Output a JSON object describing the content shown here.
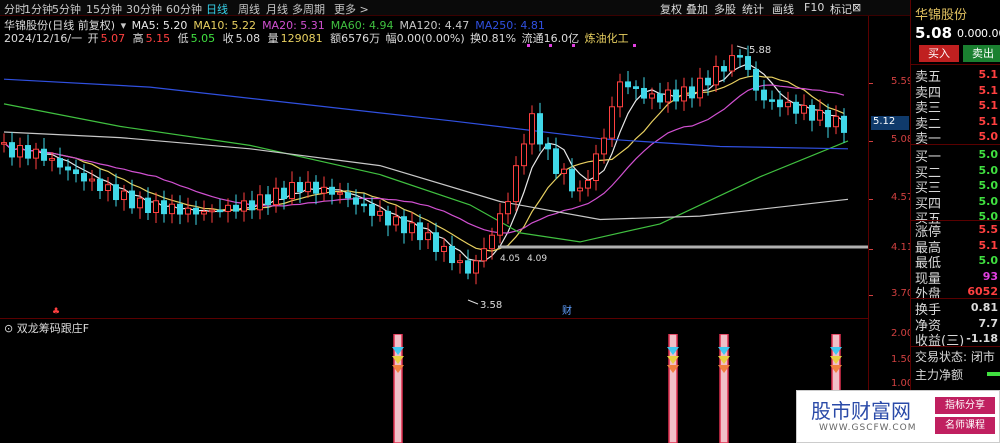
{
  "toolbar": {
    "timeframes": [
      "分时",
      "1分钟",
      "5分钟",
      "15分钟",
      "30分钟",
      "60分钟",
      "日线",
      "周线",
      "月线",
      "多周期",
      "更多 >"
    ],
    "active": "日线",
    "tools": [
      "复权",
      "叠加",
      "多股",
      "统计",
      "画线",
      "F10",
      "标记"
    ]
  },
  "stock": {
    "title": "华锦股份(日线 前复权)",
    "ma": [
      {
        "label": "MA5: 5.20",
        "color": "#e8e8e8"
      },
      {
        "label": "MA10: 5.22",
        "color": "#e8d060"
      },
      {
        "label": "MA20: 5.31",
        "color": "#d050d0"
      },
      {
        "label": "MA60: 4.94",
        "color": "#40c040"
      },
      {
        "label": "MA120: 4.47",
        "color": "#c8c8c8"
      },
      {
        "label": "MA250: 4.81",
        "color": "#3050e0"
      }
    ],
    "date": "2024/12/16/一",
    "open_label": "开",
    "open": "5.07",
    "high_label": "高",
    "high": "5.15",
    "low_label": "低",
    "low": "5.05",
    "close_label": "收",
    "close": "5.08",
    "vol_label": "量",
    "vol": "129081",
    "amt": "额6576万",
    "chg": "幅0.00(0.00%)",
    "turn": "换0.81%",
    "float": "流通16.0亿",
    "sector": "炼油化工"
  },
  "axis": {
    "main": [
      "5.59",
      "5.08",
      "4.57",
      "4.11",
      "3.70"
    ],
    "sub": [
      "2.00",
      "1.50",
      "1.00"
    ],
    "current": "5.12"
  },
  "annotations": {
    "high": "5.88",
    "low": "3.58",
    "a": "4.05",
    "b": "4.09",
    "cai": "财"
  },
  "indicator": {
    "title": "双龙筹码跟庄F"
  },
  "quote": {
    "name": "华锦股份",
    "price": "5.08",
    "chg": "0.00",
    "pct": "0.00",
    "buy": "买入",
    "sell": "卖出",
    "asks": [
      {
        "label": "卖五",
        "val": "5.1"
      },
      {
        "label": "卖四",
        "val": "5.1"
      },
      {
        "label": "卖三",
        "val": "5.1"
      },
      {
        "label": "卖二",
        "val": "5.1"
      },
      {
        "label": "卖一",
        "val": "5.0"
      }
    ],
    "bids": [
      {
        "label": "买一",
        "val": "5.0"
      },
      {
        "label": "买二",
        "val": "5.0"
      },
      {
        "label": "买三",
        "val": "5.0"
      },
      {
        "label": "买四",
        "val": "5.0"
      },
      {
        "label": "买五",
        "val": "5.0"
      }
    ],
    "stats": [
      {
        "label": "涨停",
        "val": "5.5",
        "color": "#ff4040"
      },
      {
        "label": "最高",
        "val": "5.1",
        "color": "#ff4040"
      },
      {
        "label": "最低",
        "val": "5.0",
        "color": "#40e040"
      },
      {
        "label": "现量",
        "val": "93",
        "color": "#e040e0"
      },
      {
        "label": "外盘",
        "val": "6052",
        "color": "#ff4040"
      }
    ],
    "stats2": [
      {
        "label": "换手",
        "val": "0.81"
      },
      {
        "label": "净资",
        "val": "7.7"
      },
      {
        "label": "收益(三)",
        "val": "-1.18"
      }
    ],
    "status": "交易状态: 闭市",
    "netflow": "主力净额"
  },
  "watermark": {
    "main": "股市财富网",
    "url": "WWW.GSCFW.COM",
    "tag1": "指标分享",
    "tag2": "名师课程"
  }
}
